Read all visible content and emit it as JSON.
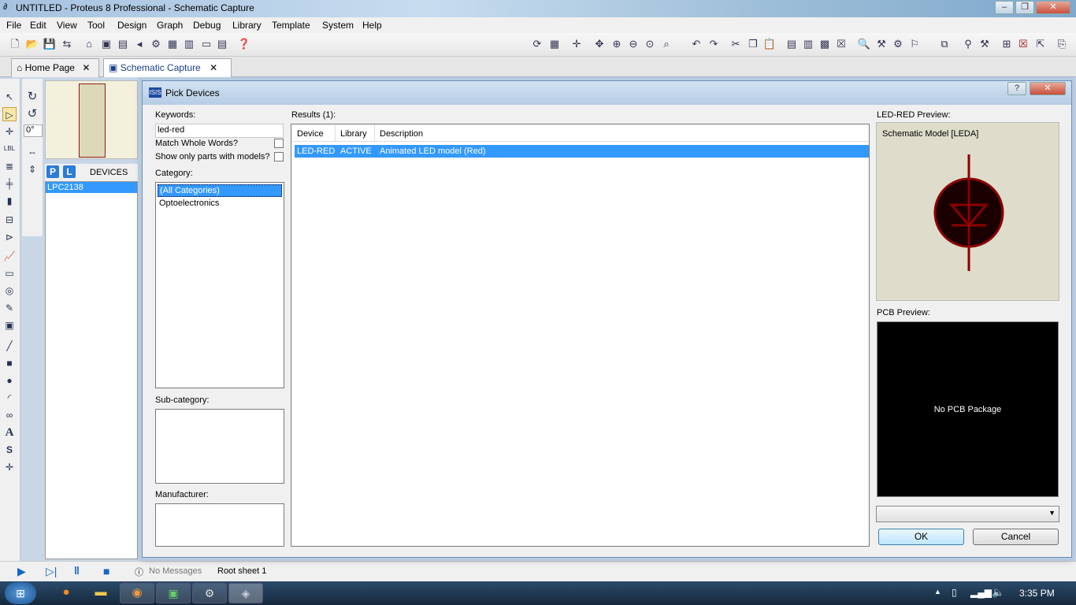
{
  "window": {
    "title": "UNTITLED - Proteus 8 Professional - Schematic Capture",
    "icon": "proteus-icon"
  },
  "menu": [
    "File",
    "Edit",
    "View",
    "Tool",
    "Design",
    "Graph",
    "Debug",
    "Library",
    "Template",
    "System",
    "Help"
  ],
  "tabs": [
    {
      "label": "Home Page"
    },
    {
      "label": "Schematic Capture"
    }
  ],
  "left_panel": {
    "rotation": "0°",
    "p_btn": "P",
    "l_btn": "L",
    "devices_label": "DEVICES",
    "devices": [
      "LPC2138"
    ]
  },
  "dialog": {
    "title": "Pick Devices",
    "keywords_label": "Keywords:",
    "keywords_value": "led-red",
    "match_whole_words": "Match Whole Words?",
    "show_only_models": "Show only parts with models?",
    "category_label": "Category:",
    "categories": [
      "(All Categories)",
      "Optoelectronics"
    ],
    "subcategory_label": "Sub-category:",
    "manufacturer_label": "Manufacturer:",
    "results_label": "Results (1):",
    "columns": [
      "Device",
      "Library",
      "Description"
    ],
    "rows": [
      {
        "device": "LED-RED",
        "library": "ACTIVE",
        "description": "Animated LED model (Red)"
      }
    ],
    "preview_label": "LED-RED Preview:",
    "schematic_model": "Schematic Model [LEDA]",
    "pcb_label": "PCB Preview:",
    "no_pcb": "No PCB Package",
    "ok": "OK",
    "cancel": "Cancel"
  },
  "statusbar": {
    "messages": "No Messages",
    "sheet": "Root sheet 1"
  },
  "taskbar": {
    "time": "3:35 PM"
  }
}
